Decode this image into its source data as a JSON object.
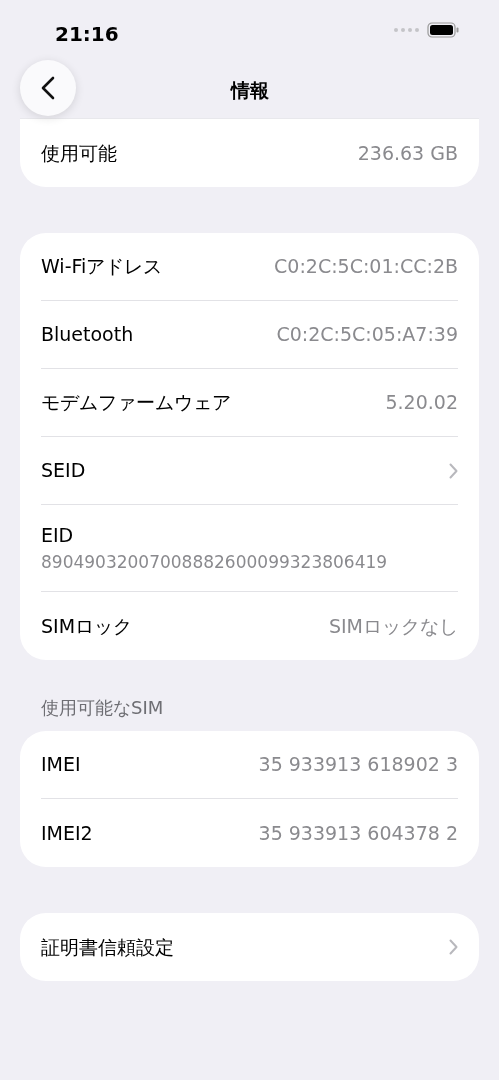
{
  "status_bar": {
    "time": "21:16"
  },
  "nav": {
    "title": "情報"
  },
  "groups": [
    {
      "rows": [
        {
          "kind": "value",
          "label": "使用可能",
          "value": "236.63 GB"
        }
      ]
    },
    {
      "rows": [
        {
          "kind": "value",
          "label": "Wi-Fiアドレス",
          "value": "C0:2C:5C:01:CC:2B"
        },
        {
          "kind": "value",
          "label": "Bluetooth",
          "value": "C0:2C:5C:05:A7:39"
        },
        {
          "kind": "value",
          "label": "モデムファームウェア",
          "value": "5.20.02"
        },
        {
          "kind": "link",
          "label": "SEID"
        },
        {
          "kind": "stacked",
          "label": "EID",
          "value": "89049032007008882600099323806419"
        },
        {
          "kind": "value",
          "label": "SIMロック",
          "value": "SIMロックなし"
        }
      ]
    },
    {
      "header": "使用可能なSIM",
      "rows": [
        {
          "kind": "value",
          "label": "IMEI",
          "value": "35 933913 618902 3"
        },
        {
          "kind": "value",
          "label": "IMEI2",
          "value": "35 933913 604378 2"
        }
      ]
    },
    {
      "rows": [
        {
          "kind": "link",
          "label": "証明書信頼設定"
        }
      ]
    }
  ]
}
